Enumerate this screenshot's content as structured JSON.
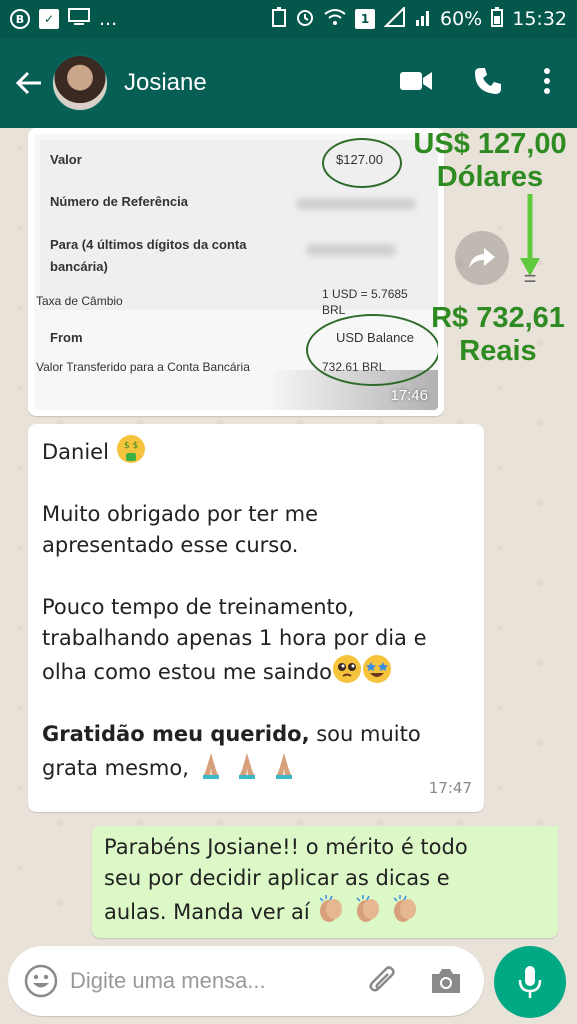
{
  "status_bar": {
    "badge_b": "B",
    "dots": "...",
    "sim": "1",
    "battery": "60%",
    "time": "15:32"
  },
  "header": {
    "contact_name": "Josiane"
  },
  "receipt": {
    "valor_label": "Valor",
    "valor_value": "$127.00",
    "referencia_label": "Número de Referência",
    "para_label": "Para (4 últimos dígitos da conta bancária)",
    "taxa_label": "Taxa de Câmbio",
    "taxa_value": "1 USD = 5.7685 BRL",
    "from_label": "From",
    "from_value": "USD Balance",
    "transferido_label": "Valor Transferido para a Conta Bancária",
    "transferido_value": "732.61 BRL",
    "time": "17:46"
  },
  "annotations": {
    "usd_line1": "US$ 127,00",
    "usd_line2": "Dólares",
    "equals": "=",
    "brl_line1": "R$ 732,61",
    "brl_line2": "Reais",
    "color": "#2e8b22"
  },
  "message_in": {
    "line_1": "Daniel",
    "line_2": "Muito obrigado por ter me",
    "line_3": "apresentado esse curso.",
    "line_4": "Pouco tempo de treinamento,",
    "line_5": "trabalhando apenas 1 hora por dia e",
    "line_6": "olha como estou me saindo",
    "line_7_bold": "Gratidão meu querido,",
    "line_7_rest": " sou muito",
    "line_8": "grata mesmo,",
    "time": "17:47"
  },
  "message_out": {
    "line_1": "Parabéns Josiane!! o mérito é todo",
    "line_2": "seu por decidir aplicar as dicas e",
    "line_3": "aulas. Manda ver aí"
  },
  "input": {
    "placeholder": "Digite uma mensa..."
  },
  "colors": {
    "header": "#075e54",
    "statusbar": "#04574b",
    "bubble_out": "#dcf8c6",
    "mic": "#00a884"
  }
}
